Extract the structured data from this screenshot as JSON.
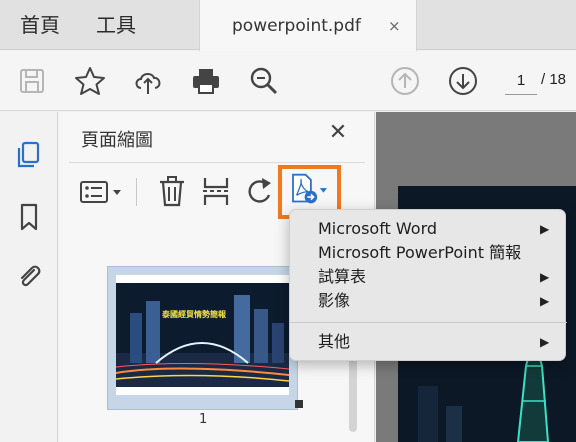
{
  "nav_tabs": {
    "home": "首頁",
    "tools": "工具"
  },
  "document_tab": {
    "title": "powerpoint.pdf",
    "close": "×"
  },
  "toolbar": {
    "icons": [
      "save-icon",
      "bookmark-star-icon",
      "upload-cloud-icon",
      "print-icon",
      "search-zoom-icon",
      "page-up-icon",
      "page-down-icon"
    ],
    "page_current": "1",
    "page_total": "/ 18"
  },
  "left_rail": {
    "icons": [
      "page-thumbnails-icon",
      "bookmarks-icon",
      "attachments-icon"
    ]
  },
  "panel": {
    "title": "頁面縮圖",
    "close": "✕",
    "tools": [
      "thumbnail-options-icon",
      "delete-icon",
      "extract-icon",
      "rotate-icon",
      "export-pdf-icon"
    ],
    "thumbnail": {
      "page_label": "1",
      "slide_text": "泰國經貿情勢簡報"
    }
  },
  "export_menu": {
    "items": [
      {
        "label": "Microsoft Word",
        "submenu": true
      },
      {
        "label": "Microsoft PowerPoint 簡報",
        "submenu": false
      },
      {
        "label": "試算表",
        "submenu": true
      },
      {
        "label": "影像",
        "submenu": true
      },
      {
        "label": "其他",
        "submenu": true
      }
    ],
    "arrow": "▶"
  },
  "colors": {
    "highlight": "#f07a1e",
    "accent": "#2a6fc9",
    "panel": "#f7f7f7",
    "thumb_selected": "#c6d6e6"
  }
}
